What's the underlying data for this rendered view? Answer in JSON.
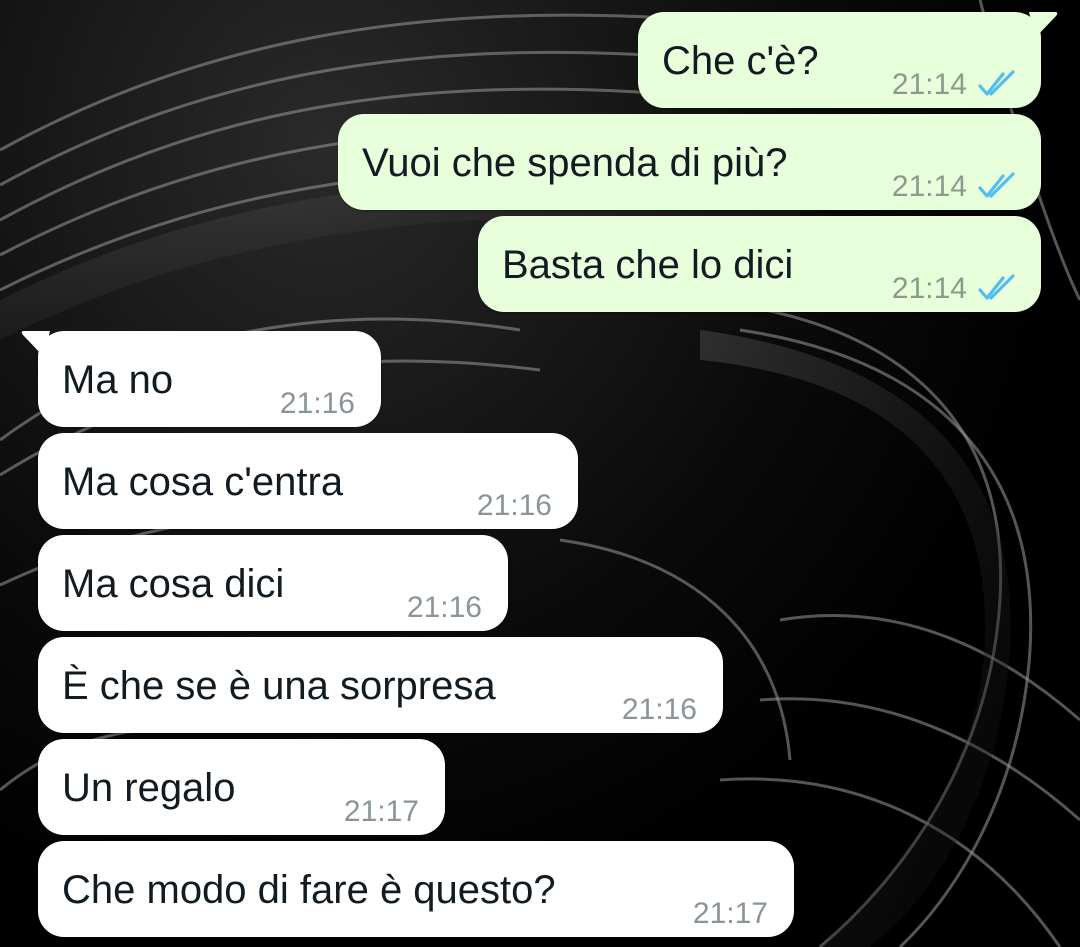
{
  "colors": {
    "outgoing_bubble": "#e7ffdb",
    "incoming_bubble": "#ffffff",
    "read_ticks": "#53bdeb",
    "time_text": "#8a9599"
  },
  "messages": [
    {
      "direction": "out",
      "text": "Che c'è?",
      "time": "21:14",
      "status_icon": "double-check-read-icon"
    },
    {
      "direction": "out",
      "text": "Vuoi che spenda di più?",
      "time": "21:14",
      "status_icon": "double-check-read-icon"
    },
    {
      "direction": "out",
      "text": "Basta che lo dici",
      "time": "21:14",
      "status_icon": "double-check-read-icon"
    },
    {
      "direction": "in",
      "text": "Ma no",
      "time": "21:16"
    },
    {
      "direction": "in",
      "text": "Ma cosa c'entra",
      "time": "21:16"
    },
    {
      "direction": "in",
      "text": "Ma cosa dici",
      "time": "21:16"
    },
    {
      "direction": "in",
      "text": "È che se è una sorpresa",
      "time": "21:16"
    },
    {
      "direction": "in",
      "text": "Un regalo",
      "time": "21:17"
    },
    {
      "direction": "in",
      "text": "Che modo di fare è questo?",
      "time": "21:17"
    }
  ]
}
